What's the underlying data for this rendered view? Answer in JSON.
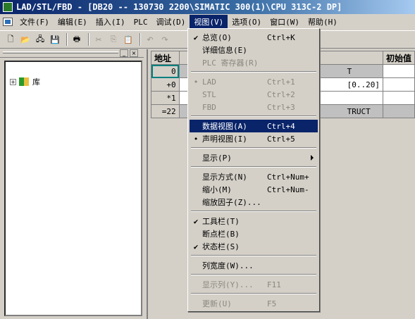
{
  "window": {
    "title": "LAD/STL/FBD  - [DB20 -- 130730 2200\\SIMATIC 300(1)\\CPU 313C-2 DP]"
  },
  "menubar": {
    "items": [
      "文件(F)",
      "编辑(E)",
      "插入(I)",
      "PLC",
      "调试(D)",
      "视图(V)",
      "选项(O)",
      "窗口(W)",
      "帮助(H)"
    ],
    "active_index": 5
  },
  "toolbar": {
    "icons": [
      "new-icon",
      "open-icon",
      "network-icon",
      "save-icon",
      "print-icon",
      "cut-icon",
      "copy-icon",
      "paste-icon",
      "undo-icon",
      "redo-icon",
      "help-pointer-icon"
    ],
    "symbols": {
      "new": "🗋",
      "open": "📂",
      "network": "🖧",
      "save": "💾",
      "print": "🖶",
      "cut": "✂",
      "copy": "⎘",
      "paste": "📋",
      "undo": "↶",
      "redo": "↷",
      "help": "?"
    }
  },
  "left_panel": {
    "tree": [
      {
        "label": "库",
        "expander": "+"
      }
    ],
    "btn_minimize": "_",
    "btn_close": "×"
  },
  "table": {
    "headers": [
      "地址",
      "初始值"
    ],
    "rows": [
      {
        "address": "0",
        "decl": "T"
      },
      {
        "address": "+0",
        "decl": "[0..20]"
      },
      {
        "address": "*1",
        "decl": ""
      },
      {
        "address": "=22",
        "decl": "TRUCT"
      }
    ]
  },
  "view_menu": {
    "items": [
      {
        "label": "总览(O)",
        "accel": "Ctrl+K",
        "mark": "✔",
        "disabled": false
      },
      {
        "label": "详细信息(E)",
        "accel": "",
        "mark": "",
        "disabled": false
      },
      {
        "label": "PLC 寄存器(R)",
        "accel": "",
        "mark": "",
        "disabled": true
      },
      {
        "label": "LAD",
        "accel": "Ctrl+1",
        "mark": "•",
        "disabled": true
      },
      {
        "label": "STL",
        "accel": "Ctrl+2",
        "mark": "",
        "disabled": true
      },
      {
        "label": "FBD",
        "accel": "Ctrl+3",
        "mark": "",
        "disabled": true
      },
      {
        "label": "数据视图(A)",
        "accel": "Ctrl+4",
        "mark": "",
        "disabled": false
      },
      {
        "label": "声明视图(I)",
        "accel": "Ctrl+5",
        "mark": "•",
        "disabled": false
      },
      {
        "label": "显示(P)",
        "accel": "",
        "mark": "",
        "disabled": false
      },
      {
        "label": "显示方式(N)",
        "accel": "Ctrl+Num+",
        "mark": "",
        "disabled": false
      },
      {
        "label": "缩小(M)",
        "accel": "Ctrl+Num-",
        "mark": "",
        "disabled": false
      },
      {
        "label": "缩放因子(Z)...",
        "accel": "",
        "mark": "",
        "disabled": false
      },
      {
        "label": "工具栏(T)",
        "accel": "",
        "mark": "✔",
        "disabled": false
      },
      {
        "label": "断点栏(B)",
        "accel": "",
        "mark": "",
        "disabled": false
      },
      {
        "label": "状态栏(S)",
        "accel": "",
        "mark": "✔",
        "disabled": false
      },
      {
        "label": "列宽度(W)...",
        "accel": "",
        "mark": "",
        "disabled": false
      },
      {
        "label": "显示列(Y)...",
        "accel": "F11",
        "mark": "",
        "disabled": true
      },
      {
        "label": "更新(U)",
        "accel": "F5",
        "mark": "",
        "disabled": true
      }
    ],
    "highlighted_index": 6,
    "submenu_index": 8
  }
}
